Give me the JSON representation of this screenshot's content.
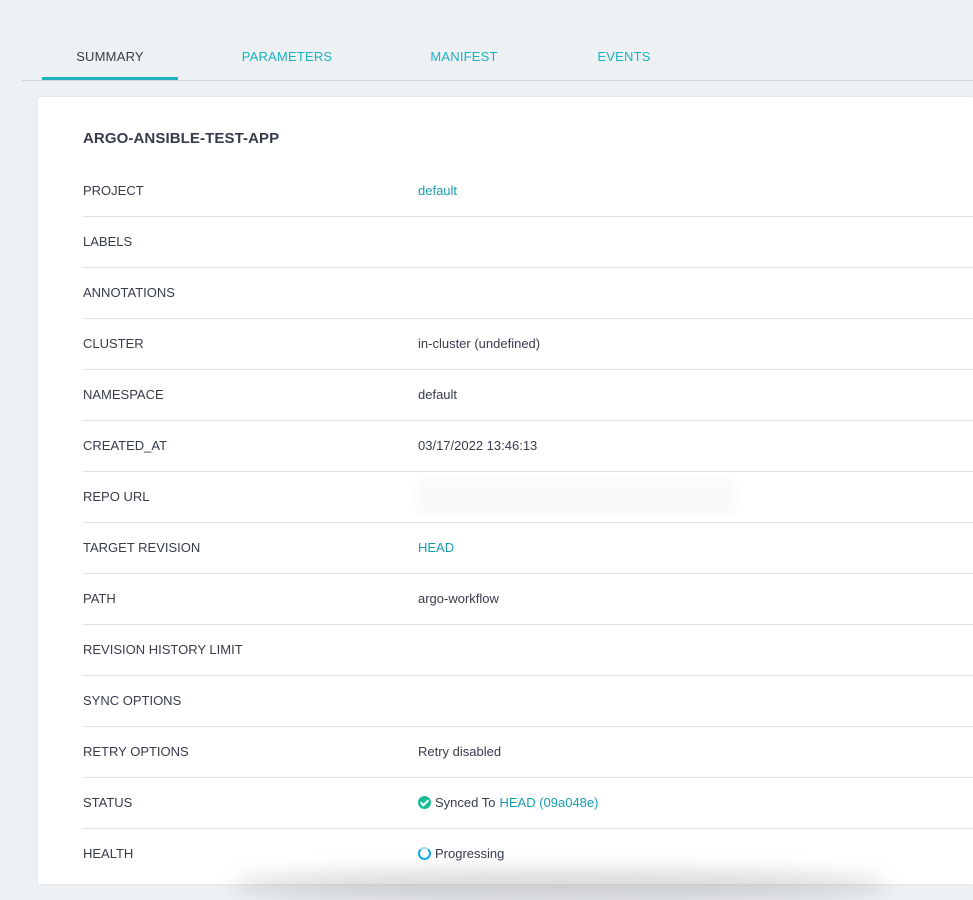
{
  "tabs": [
    {
      "label": "SUMMARY",
      "active": true
    },
    {
      "label": "PARAMETERS",
      "active": false
    },
    {
      "label": "MANIFEST",
      "active": false
    },
    {
      "label": "EVENTS",
      "active": false
    }
  ],
  "app": {
    "title": "ARGO-ANSIBLE-TEST-APP"
  },
  "rows": {
    "project": {
      "label": "PROJECT",
      "value": "default"
    },
    "labels": {
      "label": "LABELS"
    },
    "annotations": {
      "label": "ANNOTATIONS"
    },
    "cluster": {
      "label": "CLUSTER",
      "value": "in-cluster (undefined)"
    },
    "namespace": {
      "label": "NAMESPACE",
      "value": "default"
    },
    "created_at": {
      "label": "CREATED_AT",
      "value": "03/17/2022 13:46:13"
    },
    "repo_url": {
      "label": "REPO URL"
    },
    "target_revision": {
      "label": "TARGET REVISION",
      "value": "HEAD"
    },
    "path": {
      "label": "PATH",
      "value": "argo-workflow"
    },
    "revision_history_limit": {
      "label": "REVISION HISTORY LIMIT"
    },
    "sync_options": {
      "label": "SYNC OPTIONS"
    },
    "retry_options": {
      "label": "RETRY OPTIONS",
      "value": "Retry disabled"
    },
    "status": {
      "label": "STATUS",
      "text": "Synced To",
      "revision": "HEAD (09a048e)",
      "icon": "check-circle-icon"
    },
    "health": {
      "label": "HEALTH",
      "value": "Progressing",
      "icon": "progress-circle-icon"
    }
  },
  "colors": {
    "accent": "#179eae",
    "synced": "#18be94",
    "progressing": "#0dadea"
  }
}
